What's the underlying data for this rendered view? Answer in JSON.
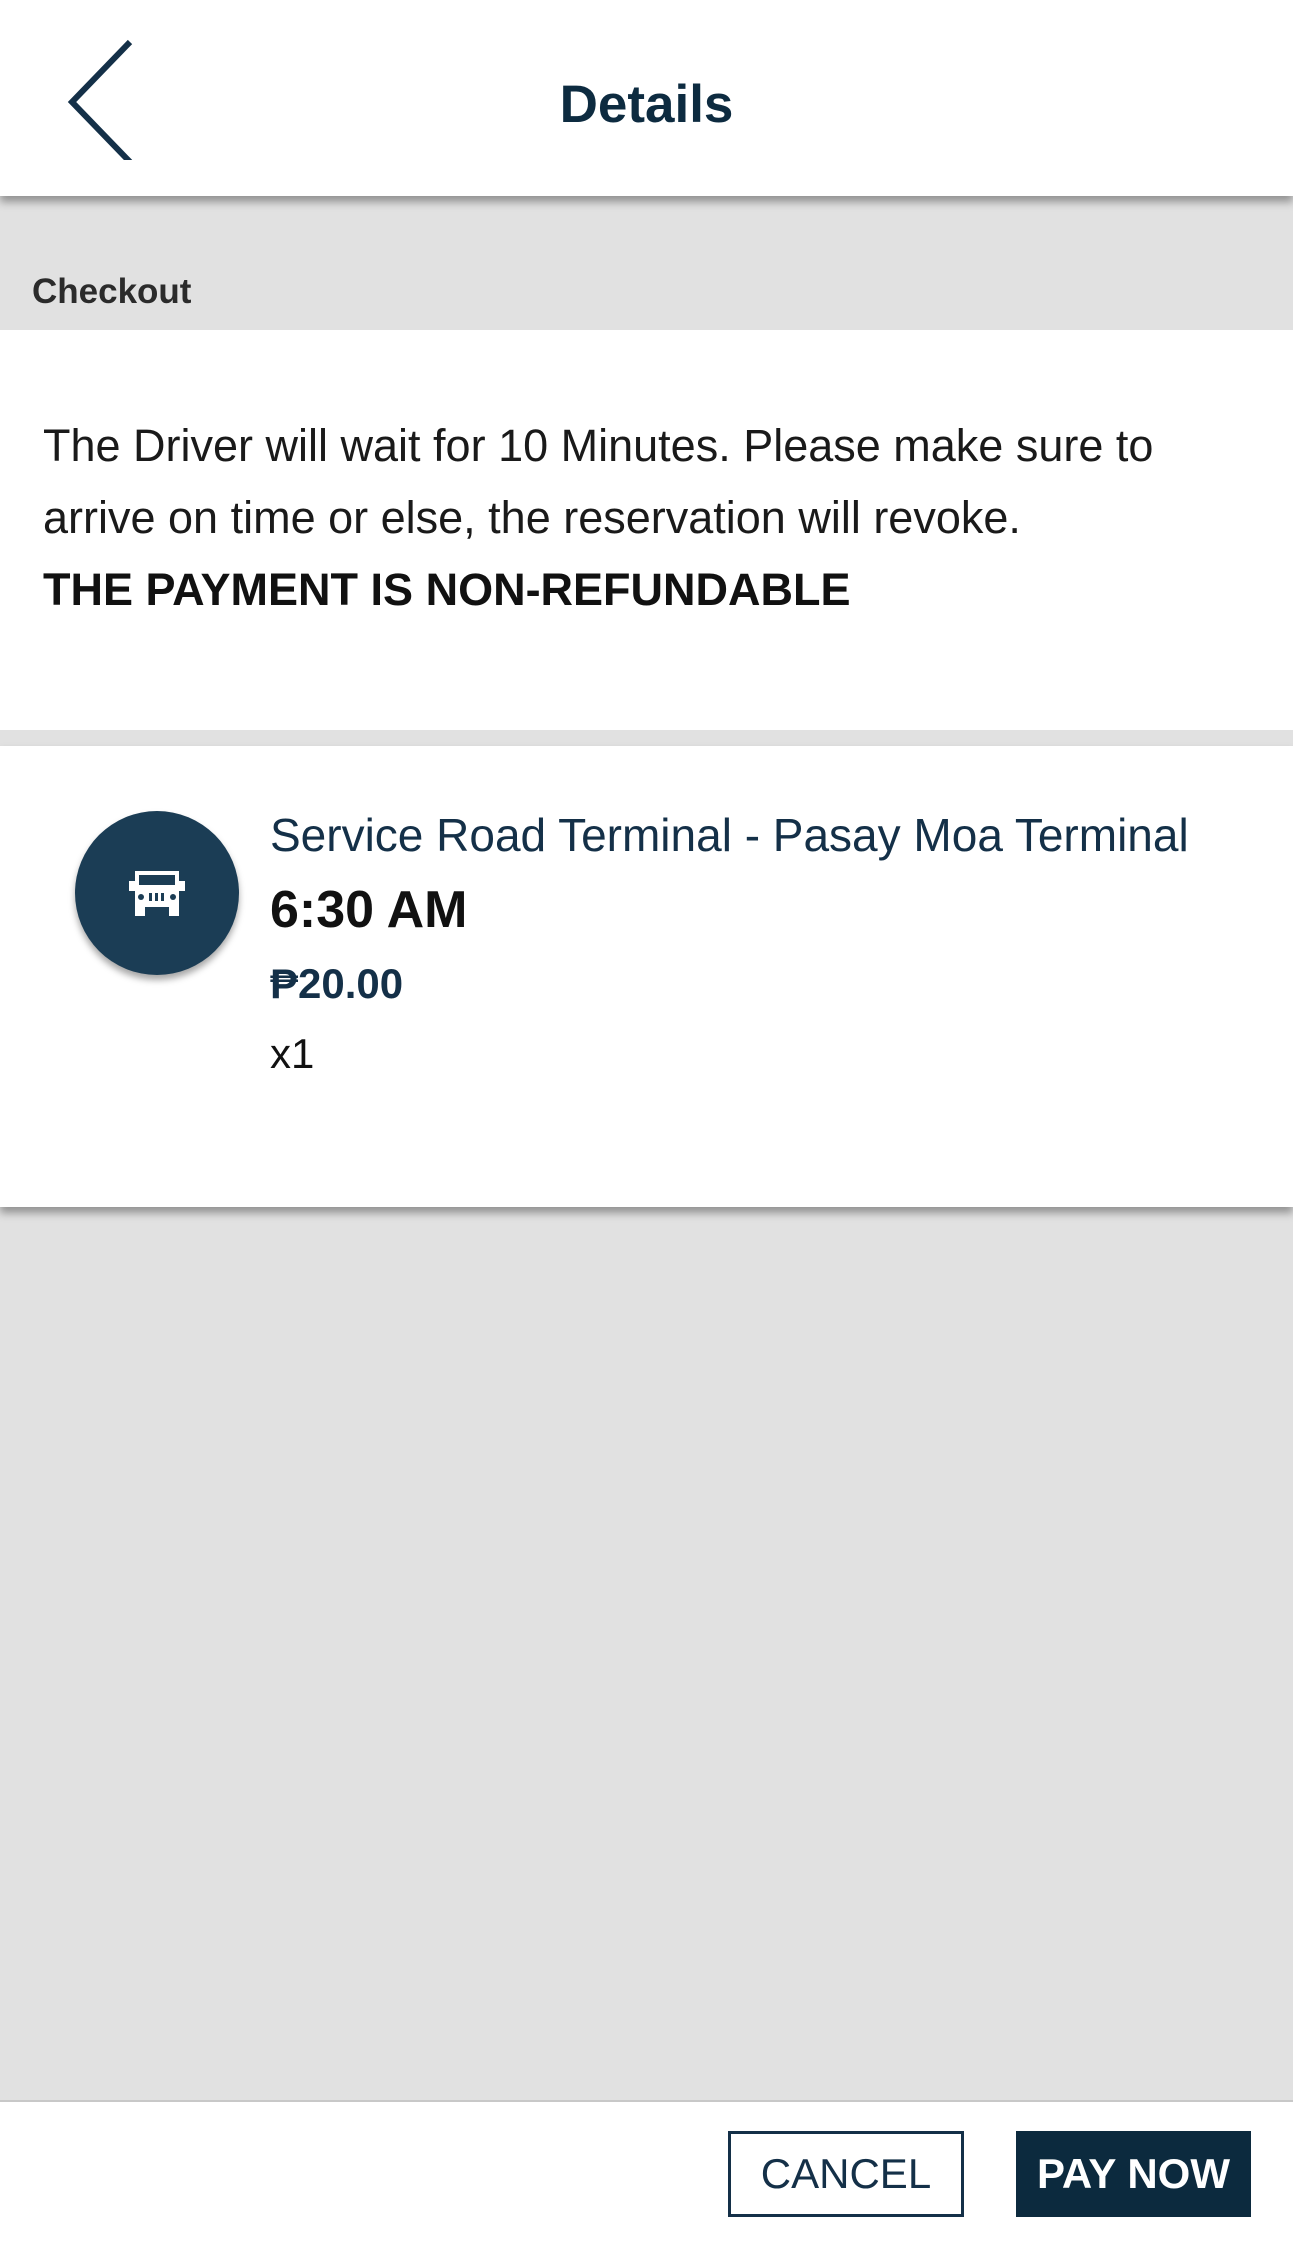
{
  "header": {
    "title": "Details",
    "back_icon": "chevron-left-icon"
  },
  "section": {
    "label": "Checkout"
  },
  "notice": {
    "message": "The Driver will wait for 10 Minutes. Please make sure to arrive on time or else, the reservation will revoke.",
    "warning": "THE PAYMENT IS NON-REFUNDABLE"
  },
  "trip": {
    "icon": "jeepney-icon",
    "route": "Service Road Terminal - Pasay Moa Terminal",
    "time": "6:30 AM",
    "price": "₱20.00",
    "quantity": "x1"
  },
  "footer": {
    "cancel_label": "CANCEL",
    "pay_label": "PAY NOW"
  },
  "colors": {
    "primary": "#0c2a3e",
    "background": "#e1e1e1"
  }
}
